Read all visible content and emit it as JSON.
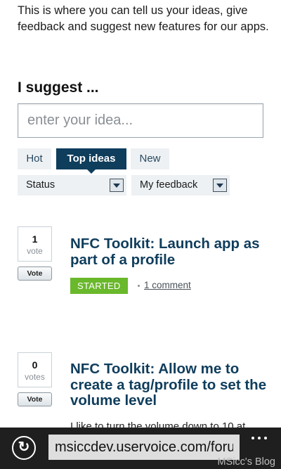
{
  "intro": "This is where you can tell us your ideas, give feedback and suggest new features for our apps.",
  "heading": "I suggest ...",
  "idea_input": {
    "placeholder": "enter your idea...",
    "value": ""
  },
  "tabs": [
    {
      "label": "Hot",
      "active": false
    },
    {
      "label": "Top ideas",
      "active": true
    },
    {
      "label": "New",
      "active": false
    }
  ],
  "filters": {
    "status": {
      "selected": "Status"
    },
    "feedback": {
      "selected": "My feedback"
    }
  },
  "ideas": [
    {
      "votes": "1",
      "votes_unit": "vote",
      "vote_button": "Vote",
      "title": "NFC Toolkit: Launch app as part of a profile",
      "status": "STARTED",
      "comments": "1 comment"
    },
    {
      "votes": "0",
      "votes_unit": "votes",
      "vote_button": "Vote",
      "title": "NFC Toolkit: Allow me to create a tag/profile to set the volume level",
      "snippet": "I like to turn the volume down to 10 at"
    }
  ],
  "browser": {
    "address": "msiccdev.uservoice.com/forums",
    "refresh_icon": "refresh-icon",
    "more_icon": "more-icon"
  },
  "watermark": "MSicc's Blog",
  "colors": {
    "accent": "#0f3d5c",
    "status_started": "#6ab82b",
    "appbar": "#1f1f1f"
  }
}
